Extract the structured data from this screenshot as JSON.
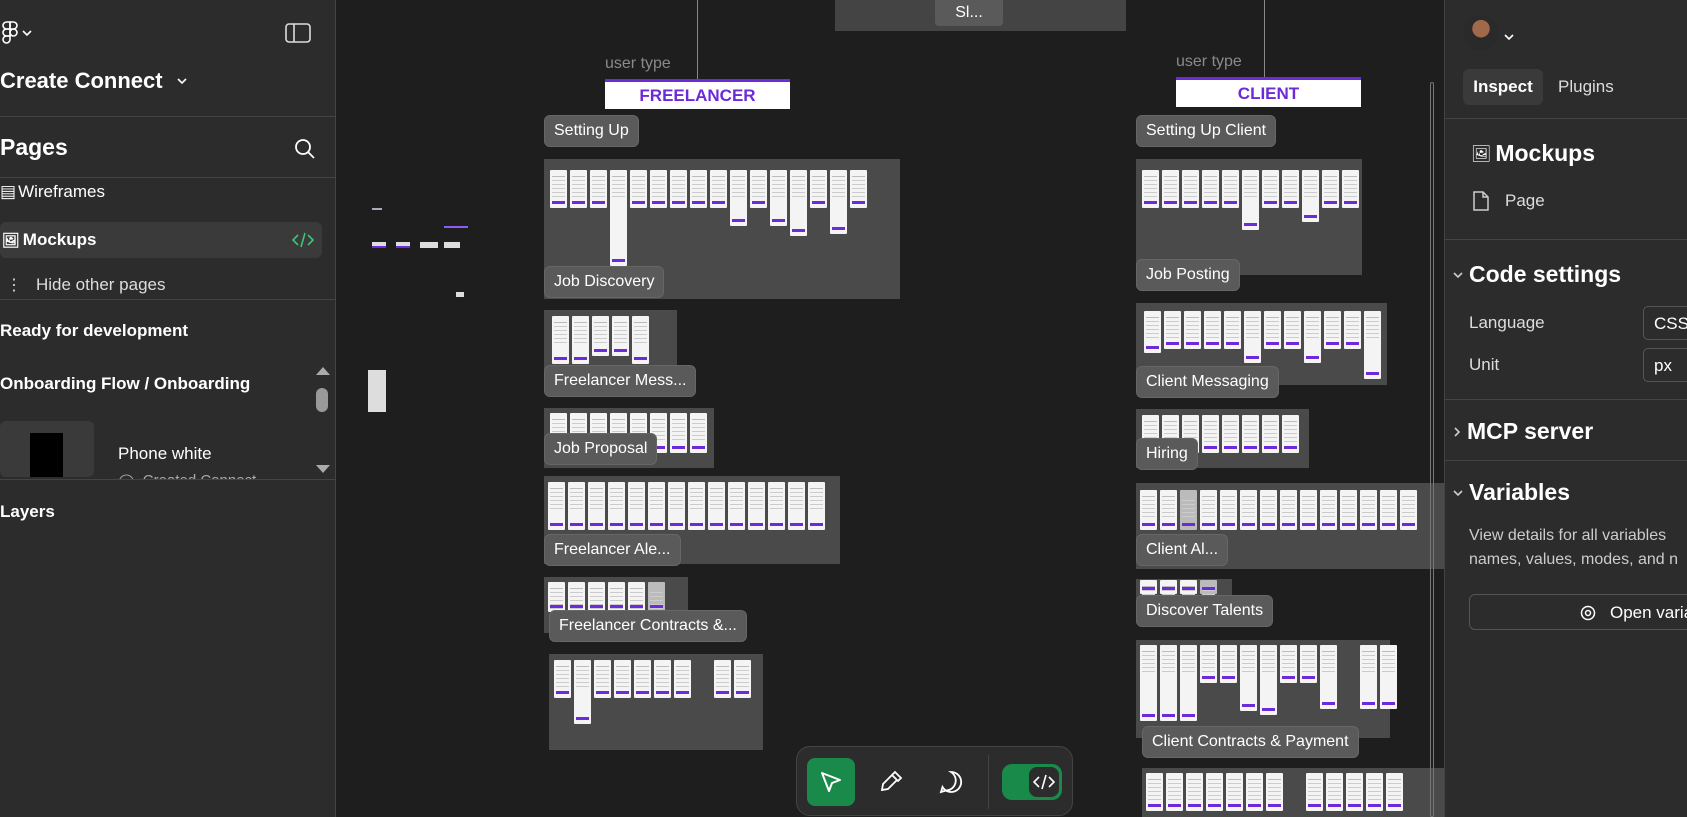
{
  "left_panel": {
    "file_name": "Create Connect",
    "pages_heading": "Pages",
    "pages": [
      {
        "label": "Wireframes",
        "emoji": "▤"
      },
      {
        "label": "Mockups",
        "emoji": "🖼"
      }
    ],
    "hide_other_pages": "Hide other pages",
    "ready_heading": "Ready for development",
    "flow_label": "Onboarding Flow / Onboarding",
    "dev_item_title": "Phone white",
    "dev_item_sub": "Created Connect",
    "layers_heading": "Layers"
  },
  "canvas": {
    "top_frame_label": "Sl...",
    "freelancer": {
      "user_type": "user type",
      "tag": "FREELANCER"
    },
    "client": {
      "user_type": "user type",
      "tag": "CLIENT"
    },
    "freelancer_sections": [
      "Setting Up",
      "Job Discovery",
      "Freelancer Mess...",
      "Job Proposal",
      "Freelancer Ale...",
      "Freelancer Contracts &..."
    ],
    "client_sections": [
      "Setting Up Client",
      "Job Posting",
      "Client Messaging",
      "Hiring",
      "Client Al...",
      "Discover Talents",
      "Client Contracts & Payment"
    ],
    "accent_color": "#6c2bd9"
  },
  "toolbar": {
    "tools": [
      "move-tool",
      "eyedropper-tool",
      "comment-tool",
      "dev-mode-toggle"
    ],
    "active_color": "#1a8a4a"
  },
  "right_panel": {
    "tabs": [
      "Inspect",
      "Plugins"
    ],
    "page_title": "Mockups",
    "page_type": "Page",
    "code_settings": "Code settings",
    "language_label": "Language",
    "language_value": "CSS",
    "unit_label": "Unit",
    "unit_value": "px",
    "mcp_server": "MCP server",
    "variables": "Variables",
    "variables_desc_1": "View details for all variables",
    "variables_desc_2": "names, values, modes, and n",
    "open_variables": "Open varia"
  }
}
